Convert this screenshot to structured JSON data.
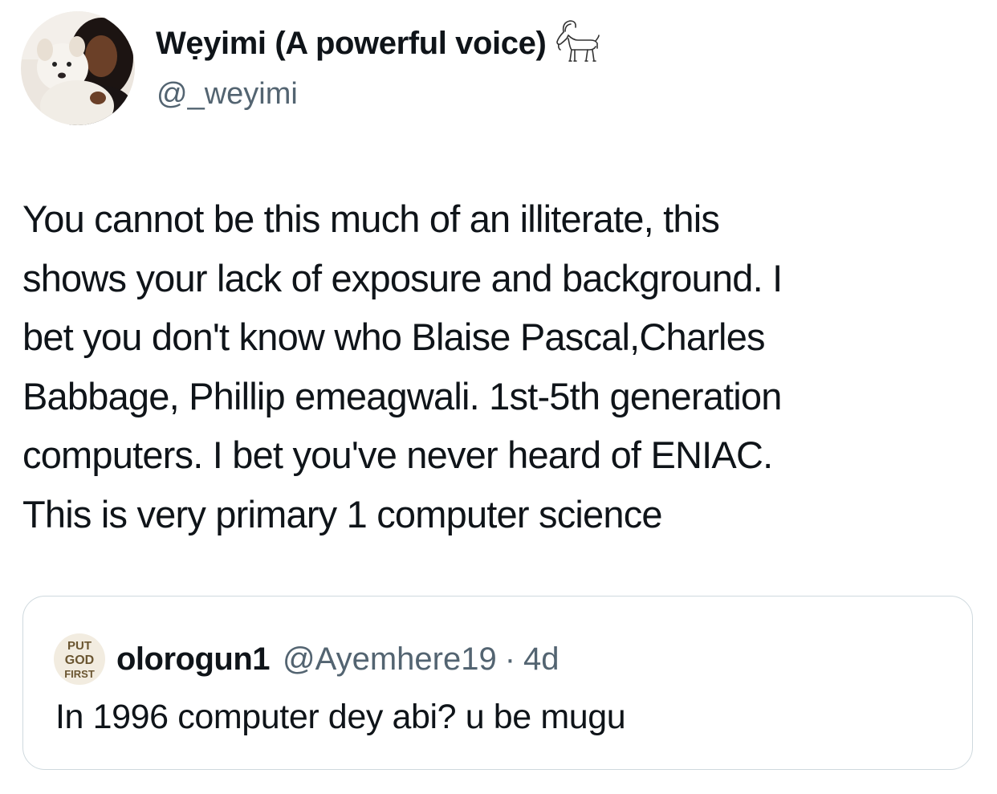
{
  "tweet": {
    "author": {
      "display_name": "Wẹyimi (A powerful voice)",
      "handle": "@_weyimi",
      "avatar_icon": "profile-photo-woman-with-dog",
      "badge_icon": "goat-emoji"
    },
    "text": "You cannot be this much of an illiterate, this\nshows your lack of exposure and background. I\nbet you don't know who Blaise Pascal,Charles\nBabbage, Phillip emeagwali. 1st-5th generation\ncomputers. I bet you've never heard of ENIAC.\nThis is very primary 1 computer science",
    "quoted": {
      "display_name": "olorogun1",
      "handle": "@Ayemhere19",
      "separator": "·",
      "time": "4d",
      "avatar_text": [
        "PUT",
        "GOD",
        "FIRST"
      ],
      "text": "In 1996 computer dey abi? u be mugu"
    }
  },
  "colors": {
    "text": "#0f1419",
    "secondary": "#536471",
    "border": "#cfd9de",
    "background": "#ffffff"
  }
}
